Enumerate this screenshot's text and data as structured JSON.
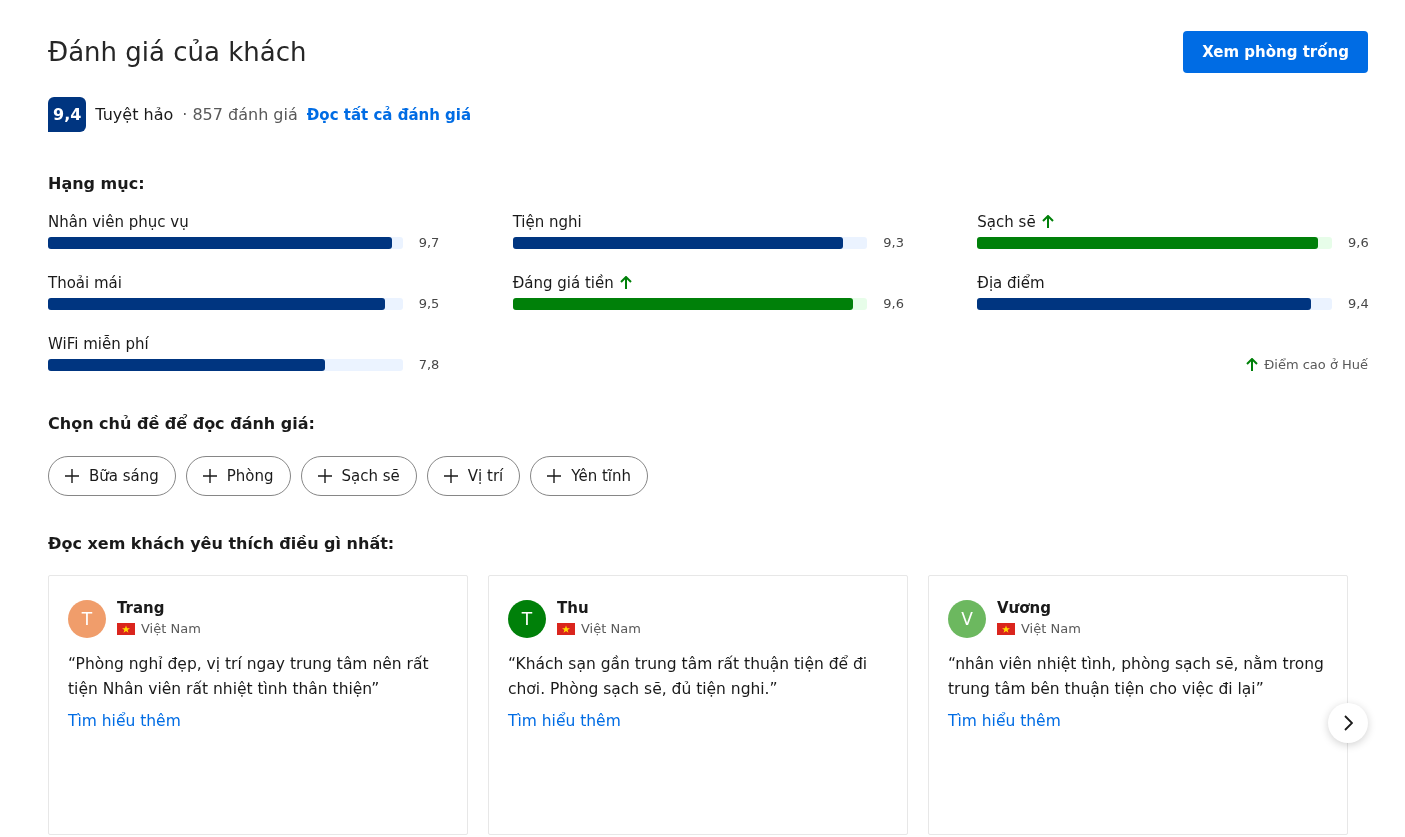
{
  "header": {
    "title": "Đánh giá của khách",
    "button": "Xem phòng trống"
  },
  "summary": {
    "score": "9,4",
    "rating": "Tuyệt hảo",
    "count": "· 857 đánh giá",
    "link": "Đọc tất cả đánh giá"
  },
  "categories_title": "Hạng mục:",
  "categories": [
    {
      "name": "Nhân viên phục vụ",
      "score": "9,7",
      "level": 0.97,
      "highlight": false
    },
    {
      "name": "Tiện nghi",
      "score": "9,3",
      "level": 0.93,
      "highlight": false
    },
    {
      "name": "Sạch sẽ",
      "score": "9,6",
      "level": 0.96,
      "highlight": true
    },
    {
      "name": "Thoải mái",
      "score": "9,5",
      "level": 0.95,
      "highlight": false
    },
    {
      "name": "Đáng giá tiền",
      "score": "9,6",
      "level": 0.96,
      "highlight": true
    },
    {
      "name": "Địa điểm",
      "score": "9,4",
      "level": 0.94,
      "highlight": false
    },
    {
      "name": "WiFi miễn phí",
      "score": "7,8",
      "level": 0.78,
      "highlight": false
    }
  ],
  "legend": "Điểm cao ở Huế",
  "topics_title": "Chọn chủ đề để đọc đánh giá:",
  "topics": [
    "Bữa sáng",
    "Phòng",
    "Sạch sẽ",
    "Vị trí",
    "Yên tĩnh"
  ],
  "reviews_title": "Đọc xem khách yêu thích điều gì nhất:",
  "reviews": [
    {
      "name": "Trang",
      "initial": "T",
      "color": "#f09d6b",
      "country": "Việt Nam",
      "text": "“Phòng nghỉ đẹp, vị trí ngay trung tâm nên rất tiện Nhân viên rất nhiệt tình thân thiện”",
      "link": "Tìm hiểu thêm"
    },
    {
      "name": "Thu",
      "initial": "T",
      "color": "#008009",
      "country": "Việt Nam",
      "text": "“Khách sạn gần trung tâm rất thuận tiện để đi chơi. Phòng sạch sẽ, đủ tiện nghi.”",
      "link": "Tìm hiểu thêm"
    },
    {
      "name": "Vương",
      "initial": "V",
      "color": "#6cb85f",
      "country": "Việt Nam",
      "text": "“nhân viên nhiệt tình, phòng sạch sẽ, nằm trong trung tâm bên thuận tiện cho việc đi lại”",
      "link": "Tìm hiểu thêm"
    }
  ]
}
